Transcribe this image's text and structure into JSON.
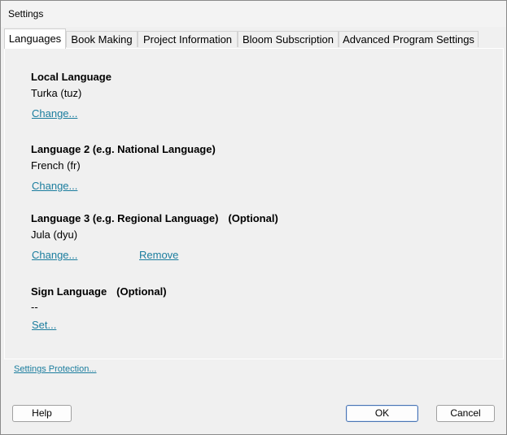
{
  "window": {
    "title": "Settings"
  },
  "tabs": [
    {
      "label": "Languages",
      "active": true
    },
    {
      "label": "Book Making",
      "active": false
    },
    {
      "label": "Project Information",
      "active": false
    },
    {
      "label": "Bloom Subscription",
      "active": false
    },
    {
      "label": "Advanced Program Settings",
      "active": false
    }
  ],
  "languages": {
    "local": {
      "heading": "Local Language",
      "value": "Turka (tuz)",
      "change_label": "Change..."
    },
    "language2": {
      "heading": "Language 2 (e.g. National Language)",
      "value": "French (fr)",
      "change_label": "Change..."
    },
    "language3": {
      "heading": "Language 3 (e.g. Regional Language)",
      "optional_label": "(Optional)",
      "value": "Jula (dyu)",
      "change_label": "Change...",
      "remove_label": "Remove"
    },
    "sign": {
      "heading": "Sign Language",
      "optional_label": "(Optional)",
      "value": "--",
      "set_label": "Set..."
    }
  },
  "footer": {
    "settings_protection_label": "Settings Protection...",
    "help_label": "Help",
    "ok_label": "OK",
    "cancel_label": "Cancel"
  },
  "colors": {
    "link": "#1b7d9e",
    "background": "#f0f0f0",
    "default_button_border": "#4a74b4"
  }
}
